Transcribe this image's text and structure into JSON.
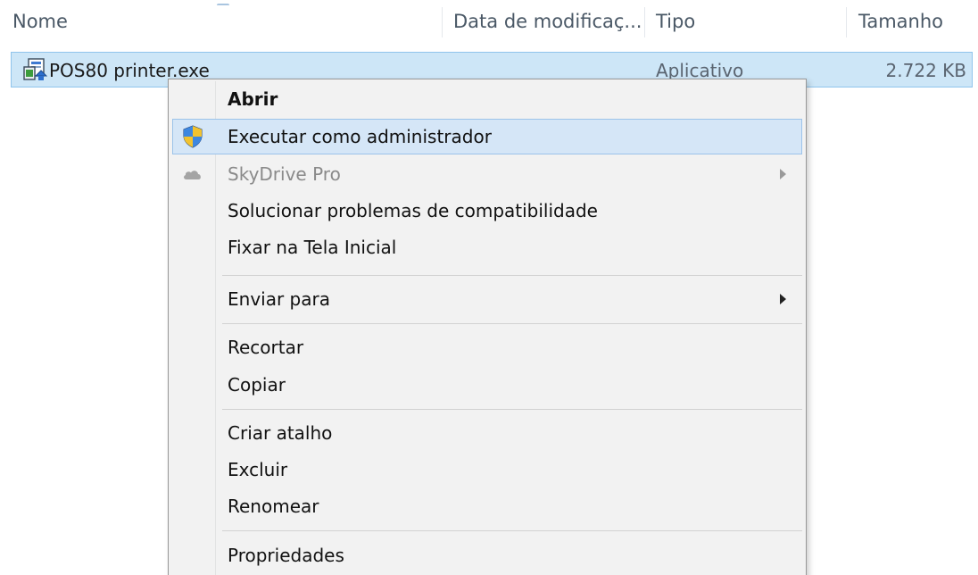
{
  "columns": {
    "name": "Nome",
    "date_modified": "Data de modificaç...",
    "type": "Tipo",
    "size": "Tamanho"
  },
  "file": {
    "name": "POS80 printer.exe",
    "type": "Aplicativo",
    "size": "2.722 KB",
    "icon": "installer-exe-icon"
  },
  "context_menu": {
    "open": "Abrir",
    "run_as_admin": "Executar como administrador",
    "skydrive_pro": "SkyDrive Pro",
    "troubleshoot_compat": "Solucionar problemas de compatibilidade",
    "pin_start": "Fixar na Tela Inicial",
    "send_to": "Enviar para",
    "cut": "Recortar",
    "copy": "Copiar",
    "create_shortcut": "Criar atalho",
    "delete": "Excluir",
    "rename": "Renomear",
    "properties": "Propriedades"
  },
  "colors": {
    "selection_bg": "#cde6f7",
    "selection_border": "#8fc4ec",
    "menu_bg": "#f2f2f2",
    "menu_hover_bg": "#d5e6f7",
    "menu_hover_border": "#9cc3ea"
  }
}
